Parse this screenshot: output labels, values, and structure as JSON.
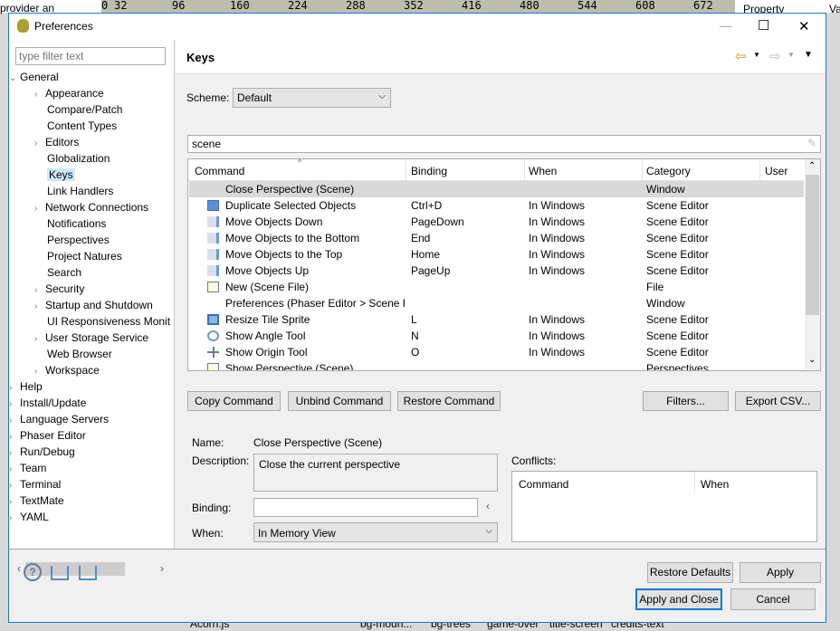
{
  "background": {
    "left_text": "provider an",
    "ruler": [
      "0",
      "32",
      "96",
      "160",
      "224",
      "288",
      "352",
      "416",
      "480",
      "544",
      "608",
      "672"
    ],
    "right_texts": [
      "Property",
      "Va"
    ],
    "bottom_texts": [
      "Acorn.js",
      "bg-moun...",
      "bg-trees",
      "game-over",
      "title-screen",
      "credits-text"
    ]
  },
  "window": {
    "title": "Preferences",
    "minimize": "—",
    "maximize": "☐",
    "close": "✕"
  },
  "sidebar": {
    "filter_placeholder": "type filter text",
    "items": [
      {
        "label": "General",
        "level": 0,
        "expanded": true
      },
      {
        "label": "Appearance",
        "level": 1,
        "arrow": true
      },
      {
        "label": "Compare/Patch",
        "level": 1
      },
      {
        "label": "Content Types",
        "level": 1
      },
      {
        "label": "Editors",
        "level": 1,
        "arrow": true
      },
      {
        "label": "Globalization",
        "level": 1
      },
      {
        "label": "Keys",
        "level": 1,
        "selected": true
      },
      {
        "label": "Link Handlers",
        "level": 1
      },
      {
        "label": "Network Connections",
        "level": 1,
        "arrow": true
      },
      {
        "label": "Notifications",
        "level": 1
      },
      {
        "label": "Perspectives",
        "level": 1
      },
      {
        "label": "Project Natures",
        "level": 1
      },
      {
        "label": "Search",
        "level": 1
      },
      {
        "label": "Security",
        "level": 1,
        "arrow": true
      },
      {
        "label": "Startup and Shutdown",
        "level": 1,
        "arrow": true
      },
      {
        "label": "UI Responsiveness Monit",
        "level": 1
      },
      {
        "label": "User Storage Service",
        "level": 1,
        "arrow": true
      },
      {
        "label": "Web Browser",
        "level": 1
      },
      {
        "label": "Workspace",
        "level": 1,
        "arrow": true
      },
      {
        "label": "Help",
        "level": 0,
        "arrow": true
      },
      {
        "label": "Install/Update",
        "level": 0,
        "arrow": true
      },
      {
        "label": "Language Servers",
        "level": 0,
        "arrow": true
      },
      {
        "label": "Phaser Editor",
        "level": 0,
        "arrow": true
      },
      {
        "label": "Run/Debug",
        "level": 0,
        "arrow": true
      },
      {
        "label": "Team",
        "level": 0,
        "arrow": true
      },
      {
        "label": "Terminal",
        "level": 0,
        "arrow": true
      },
      {
        "label": "TextMate",
        "level": 0,
        "arrow": true
      },
      {
        "label": "YAML",
        "level": 0,
        "arrow": true
      }
    ]
  },
  "page": {
    "title": "Keys",
    "scheme_label": "Scheme:",
    "scheme_value": "Default",
    "filter_value": "scene",
    "columns": [
      "Command",
      "Binding",
      "When",
      "Category",
      "User"
    ],
    "rows": [
      {
        "command": "Close Perspective (Scene)",
        "binding": "",
        "when": "",
        "category": "Window",
        "icon": "none",
        "selected": true
      },
      {
        "command": "Duplicate Selected Objects",
        "binding": "Ctrl+D",
        "when": "In Windows",
        "category": "Scene Editor",
        "icon": "duplicate-icon"
      },
      {
        "command": "Move Objects Down",
        "binding": "PageDown",
        "when": "In Windows",
        "category": "Scene Editor",
        "icon": "move-down-icon"
      },
      {
        "command": "Move Objects to the Bottom",
        "binding": "End",
        "when": "In Windows",
        "category": "Scene Editor",
        "icon": "move-bottom-icon"
      },
      {
        "command": "Move Objects to the Top",
        "binding": "Home",
        "when": "In Windows",
        "category": "Scene Editor",
        "icon": "move-top-icon"
      },
      {
        "command": "Move Objects Up",
        "binding": "PageUp",
        "when": "In Windows",
        "category": "Scene Editor",
        "icon": "move-up-icon"
      },
      {
        "command": "New (Scene File)",
        "binding": "",
        "when": "",
        "category": "File",
        "icon": "new-file-icon"
      },
      {
        "command": "Preferences (Phaser Editor > Scene Edi",
        "binding": "",
        "when": "",
        "category": "Window",
        "icon": "none"
      },
      {
        "command": "Resize Tile Sprite",
        "binding": "L",
        "when": "In Windows",
        "category": "Scene Editor",
        "icon": "resize-icon"
      },
      {
        "command": "Show Angle Tool",
        "binding": "N",
        "when": "In Windows",
        "category": "Scene Editor",
        "icon": "angle-icon"
      },
      {
        "command": "Show Origin Tool",
        "binding": "O",
        "when": "In Windows",
        "category": "Scene Editor",
        "icon": "origin-icon"
      },
      {
        "command": "Show Perspective (Scene)",
        "binding": "",
        "when": "",
        "category": "Perspectives",
        "icon": "new-file-icon"
      }
    ],
    "buttons": {
      "copy": "Copy Command",
      "unbind": "Unbind Command",
      "restore": "Restore Command",
      "filters": "Filters...",
      "export": "Export CSV..."
    },
    "details": {
      "name_label": "Name:",
      "name_value": "Close Perspective (Scene)",
      "description_label": "Description:",
      "description_value": "Close the current perspective",
      "binding_label": "Binding:",
      "binding_value": "",
      "when_label": "When:",
      "when_value": "In Memory View",
      "conflicts_label": "Conflicts:",
      "conflicts_columns": [
        "Command",
        "When"
      ]
    },
    "restore_defaults": "Restore Defaults",
    "apply": "Apply"
  },
  "footer": {
    "apply_close": "Apply and Close",
    "cancel": "Cancel"
  }
}
